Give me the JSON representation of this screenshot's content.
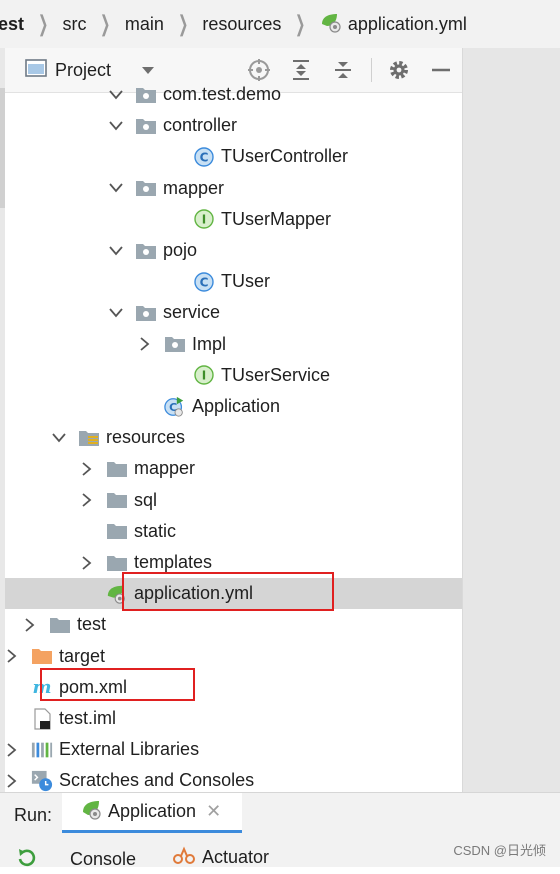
{
  "breadcrumbs": [
    "est",
    "src",
    "main",
    "resources",
    "application.yml"
  ],
  "toolwindow": {
    "title": "Project"
  },
  "tree": [
    {
      "label": "com.test.demo",
      "icon": "package",
      "indent": 157,
      "arrow": "down",
      "partial": true
    },
    {
      "label": "controller",
      "icon": "package",
      "indent": 157,
      "arrow": "down"
    },
    {
      "label": "TUserController",
      "icon": "class",
      "indent": 215,
      "arrow": "none"
    },
    {
      "label": "mapper",
      "icon": "package",
      "indent": 157,
      "arrow": "down"
    },
    {
      "label": "TUserMapper",
      "icon": "interface",
      "indent": 215,
      "arrow": "none"
    },
    {
      "label": "pojo",
      "icon": "package",
      "indent": 157,
      "arrow": "down"
    },
    {
      "label": "TUser",
      "icon": "class",
      "indent": 215,
      "arrow": "none"
    },
    {
      "label": "service",
      "icon": "package",
      "indent": 157,
      "arrow": "down"
    },
    {
      "label": "Impl",
      "icon": "package",
      "indent": 186,
      "arrow": "right"
    },
    {
      "label": "TUserService",
      "icon": "interface",
      "indent": 215,
      "arrow": "none"
    },
    {
      "label": "Application",
      "icon": "spring-class",
      "indent": 186,
      "arrow": "none"
    },
    {
      "label": "resources",
      "icon": "resources-folder",
      "indent": 100,
      "arrow": "down"
    },
    {
      "label": "mapper",
      "icon": "folder",
      "indent": 128,
      "arrow": "right"
    },
    {
      "label": "sql",
      "icon": "folder",
      "indent": 128,
      "arrow": "right"
    },
    {
      "label": "static",
      "icon": "folder",
      "indent": 128,
      "arrow": "none"
    },
    {
      "label": "templates",
      "icon": "folder",
      "indent": 128,
      "arrow": "right"
    },
    {
      "label": "application.yml",
      "icon": "spring-yml",
      "indent": 128,
      "arrow": "none",
      "selected": true
    },
    {
      "label": "test",
      "icon": "folder",
      "indent": 71,
      "arrow": "right"
    },
    {
      "label": "target",
      "icon": "folder-orange",
      "indent": 42,
      "arrow": "right"
    },
    {
      "label": "pom.xml",
      "icon": "maven",
      "indent": 42,
      "arrow": "none"
    },
    {
      "label": "test.iml",
      "icon": "iml-file",
      "indent": 42,
      "arrow": "none"
    },
    {
      "label": "External Libraries",
      "icon": "libraries",
      "indent": 13,
      "arrow": "right"
    },
    {
      "label": "Scratches and Consoles",
      "icon": "scratches",
      "indent": 13,
      "arrow": "right"
    }
  ],
  "run": {
    "label": "Run:",
    "tab_label": "Application",
    "console_label": "Console",
    "actuator_label": "Actuator"
  },
  "watermark": "CSDN @日光倾",
  "colors": {
    "highlight_box": "#e02020",
    "selected_row": "#d5d5d5",
    "class_icon": "#3c8bdc",
    "interface_icon": "#62b543",
    "folder": "#9aa7b0",
    "folder_orange": "#f4a261",
    "maven": "#40b6e0"
  }
}
